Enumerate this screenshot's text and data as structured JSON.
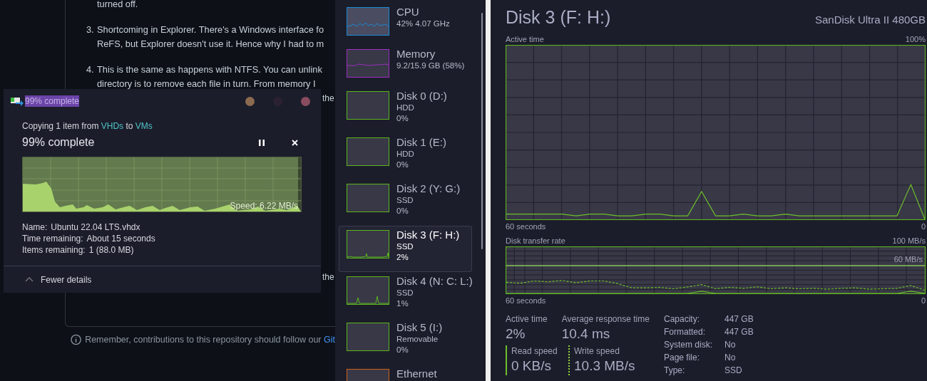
{
  "background_page": {
    "list": [
      {
        "lines": [
          "turned off."
        ]
      },
      {
        "number": "3.",
        "lines": [
          "Shortcoming in Explorer. There's a Windows interface fo",
          "ReFS, but Explorer doesn't use it. Hence why I had to m"
        ]
      },
      {
        "number": "4.",
        "lines": [
          "This is the same as happens with NTFS. You can unlink",
          "directory is to remove each file in turn. From memory I"
        ]
      }
    ],
    "fragments": [
      "the",
      "the"
    ],
    "footer": {
      "text": "Remember, contributions to this repository should follow our ",
      "link": "Git"
    }
  },
  "copy_dialog": {
    "title": "99% complete",
    "title_buttons": [
      {
        "color": "#8b6a4f"
      },
      {
        "color": "#2a2233"
      },
      {
        "color": "#8a4c5f"
      }
    ],
    "copying": [
      {
        "text": "Copying 1 item from "
      },
      {
        "text": "VHDs",
        "kind": "link"
      },
      {
        "text": " to "
      },
      {
        "text": "VMs",
        "kind": "link"
      }
    ],
    "heading": "99% complete",
    "level": 0.99,
    "speed": "Speed: 6.22 MB/s",
    "details": [
      {
        "label": "Name:",
        "value": "Ubuntu 22.04 LTS.vhdx"
      },
      {
        "label": "Time remaining:",
        "value": "About 15 seconds"
      },
      {
        "label": "Items remaining:",
        "value": "1 (88.0 MB)"
      }
    ],
    "toggle": "Fewer details"
  },
  "sidebar": {
    "items": [
      {
        "name": "CPU",
        "lines": [
          "42%  4.07 GHz"
        ],
        "color": "#1a8ad4",
        "selected": false
      },
      {
        "name": "Memory",
        "lines": [
          "9.2/15.9 GB (58%)"
        ],
        "color": "#9a2fbf",
        "selected": false
      },
      {
        "name": "Disk 0 (D:)",
        "lines": [
          "HDD",
          "0%"
        ],
        "color": "#5cb51e",
        "selected": false
      },
      {
        "name": "Disk 1 (E:)",
        "lines": [
          "HDD",
          "0%"
        ],
        "color": "#5cb51e",
        "selected": false
      },
      {
        "name": "Disk 2 (Y: G:)",
        "lines": [
          "SSD",
          "0%"
        ],
        "color": "#5cb51e",
        "selected": false
      },
      {
        "name": "Disk 3 (F: H:)",
        "lines": [
          "SSD",
          "2%"
        ],
        "color": "#5cb51e",
        "selected": true
      },
      {
        "name": "Disk 4 (N: C: L:)",
        "lines": [
          "SSD",
          "1%"
        ],
        "color": "#5cb51e",
        "selected": false
      },
      {
        "name": "Disk 5 (I:)",
        "lines": [
          "Removable",
          "0%"
        ],
        "color": "#5cb51e",
        "selected": false
      },
      {
        "name": "Ethernet",
        "color": "#c8641a",
        "selected": false
      }
    ]
  },
  "detail": {
    "title": "Disk 3 (F: H:)",
    "model": "SanDisk Ultra II 480GB",
    "active_chart": {
      "title": "Active time",
      "max_label": "100%",
      "start_label": "60 seconds",
      "end_label": "0"
    },
    "transfer_chart": {
      "title": "Disk transfer rate",
      "max_label": "100 MB/s",
      "threshold_label": "60 MB/s",
      "start_label": "60 seconds",
      "end_label": "0"
    },
    "stats": [
      {
        "label": "Active time",
        "value": "2%"
      },
      {
        "label": "Average response time",
        "value": "10.4 ms"
      }
    ],
    "speeds": [
      {
        "label": "Read speed",
        "value": "0 KB/s",
        "kind": "solid"
      },
      {
        "label": "Write speed",
        "value": "10.3 MB/s",
        "kind": "dashed"
      }
    ],
    "properties": [
      {
        "label": "Capacity:",
        "value": "447 GB"
      },
      {
        "label": "Formatted:",
        "value": "447 GB"
      },
      {
        "label": "System disk:",
        "value": "No"
      },
      {
        "label": "Page file:",
        "value": "No"
      },
      {
        "label": "Type:",
        "value": "SSD"
      }
    ]
  }
}
